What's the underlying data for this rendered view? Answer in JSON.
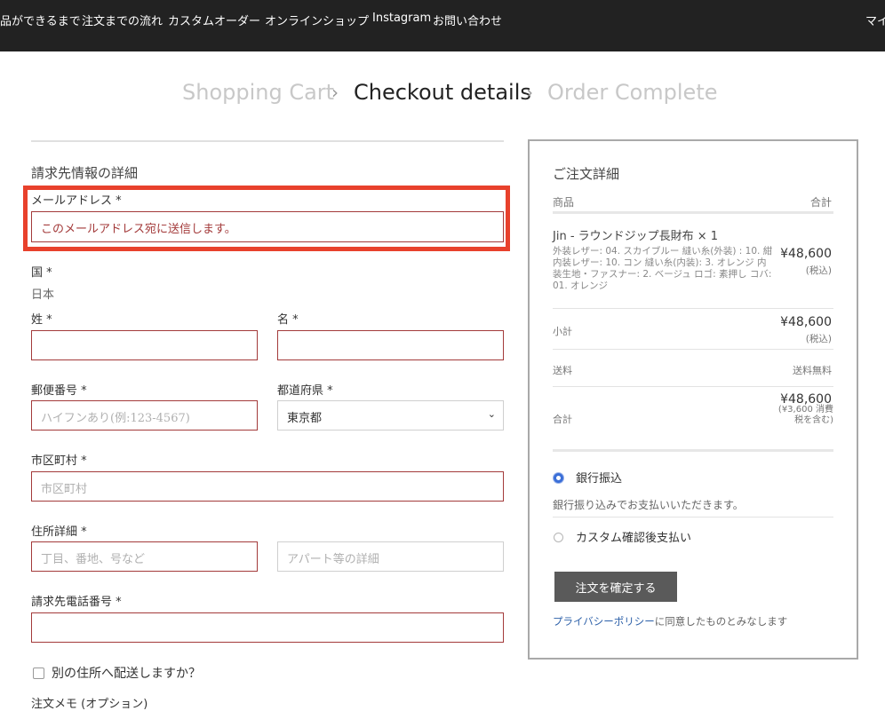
{
  "nav": {
    "items": [
      "品ができるまで",
      "注文までの流れ",
      "カスタムオーダー",
      "オンラインショップ",
      "Instagram",
      "お問い合わせ"
    ],
    "right": "マイ"
  },
  "steps": {
    "cart": "Shopping Cart",
    "details": "Checkout details",
    "complete": "Order Complete"
  },
  "billing": {
    "title": "請求先情報の詳細",
    "email_label": "メールアドレス *",
    "email_value": "このメールアドレス宛に送信します。",
    "country_label": "国 *",
    "country_value": "日本",
    "last_name_label": "姓 *",
    "first_name_label": "名 *",
    "postcode_label": "郵便番号 *",
    "postcode_placeholder": "ハイフンあり(例:123-4567)",
    "prefecture_label": "都道府県 *",
    "prefecture_value": "東京都",
    "city_label": "市区町村 *",
    "city_placeholder": "市区町村",
    "address_label": "住所詳細 *",
    "address1_placeholder": "丁目、番地、号など",
    "address2_placeholder": "アパート等の詳細",
    "phone_label": "請求先電話番号 *",
    "ship_different_label": "別の住所へ配送しますか？",
    "order_notes_label": "注文メモ (オプション)"
  },
  "summary": {
    "title": "ご注文詳細",
    "col_product": "商品",
    "col_total": "合計",
    "product_name": "Jin - ラウンドジップ長財布  × 1",
    "product_meta": "外装レザー:  04. スカイブルー  縫い糸(外装) :  10. 紺  内装レザー:  10. コン  縫い糸(内装):  3. オレンジ  内装生地・ファスナー:  2. ベージュ  ロゴ:  素押し  コバ:  01. オレンジ",
    "product_price": "¥48,600",
    "product_tax": "(税込)",
    "subtotal_label": "小計",
    "subtotal_value": "¥48,600",
    "subtotal_tax": "(税込)",
    "shipping_label": "送料",
    "shipping_value": "送料無料",
    "total_label": "合計",
    "total_value": "¥48,600",
    "total_tax_note": "(¥3,600 消費税を含む)",
    "payment_bank_label": "銀行振込",
    "payment_bank_desc": "銀行振り込みでお支払いいただきます。",
    "payment_custom_label": "カスタム確認後支払い",
    "confirm_button": "注文を確定する",
    "privacy_link": "プライバシーポリシー",
    "privacy_text": "に同意したものとみなします"
  },
  "colors": {
    "topbar": "#222222",
    "field_border": "#a33a3a",
    "highlight": "#e8412c",
    "button": "#5a5a5a",
    "link": "#2b5fa8",
    "radio_active": "#3b6fd8"
  }
}
